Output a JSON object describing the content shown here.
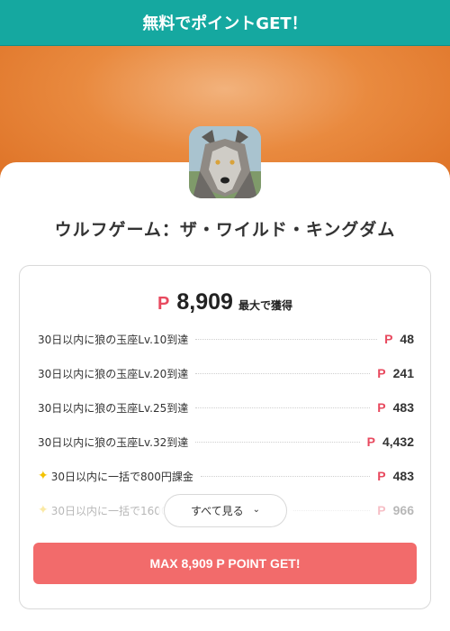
{
  "header": {
    "title": "無料でポイントGET！"
  },
  "app": {
    "title": "ウルフゲーム：ザ・ワイルド・キングダム"
  },
  "total": {
    "p": "P",
    "value": "8,909",
    "suffix": "最大で獲得"
  },
  "rewards": [
    {
      "label": "30日以内に狼の玉座Lv.10到達",
      "points": "48"
    },
    {
      "label": "30日以内に狼の玉座Lv.20到達",
      "points": "241"
    },
    {
      "label": "30日以内に狼の玉座Lv.25到達",
      "points": "483"
    },
    {
      "label": "30日以内に狼の玉座Lv.32到達",
      "points": "4,432"
    },
    {
      "label": "30日以内に一括で800円課金",
      "points": "483",
      "icon": "sparkle-icon"
    },
    {
      "label": "30日以内に一括で1600",
      "points": "966",
      "icon": "sparkle-icon"
    }
  ],
  "see_all": {
    "label": "すべて見る",
    "icon": "chevron-down-icon"
  },
  "cta": {
    "label": "MAX 8,909 P POINT GET!"
  },
  "colors": {
    "header": "#15a8a0",
    "accent": "#e84a5f",
    "cta": "#f26b6b",
    "hero": "#dd7024"
  }
}
